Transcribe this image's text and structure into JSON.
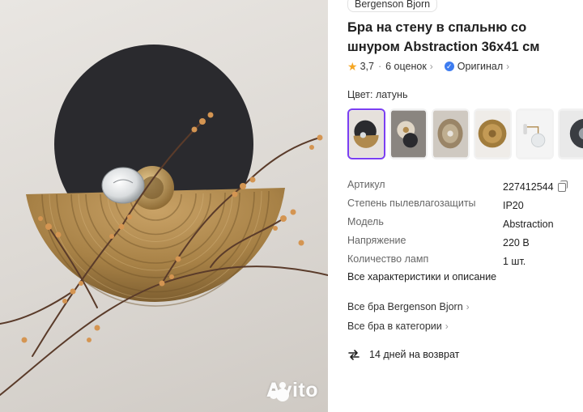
{
  "brand": {
    "label": "Bergenson Bjorn"
  },
  "product": {
    "title": "Бра на стену в спальню со шнуром Abstraction 36x41 см"
  },
  "rating": {
    "value": "3,7",
    "reviews": "6 оценок",
    "original": "Оригинал"
  },
  "color": {
    "label": "Цвет: латунь"
  },
  "thumbnails": [
    {
      "name": "thumb-1",
      "selected": true
    },
    {
      "name": "thumb-2",
      "selected": false
    },
    {
      "name": "thumb-3",
      "selected": false
    },
    {
      "name": "thumb-4",
      "selected": false
    },
    {
      "name": "thumb-5",
      "selected": false
    },
    {
      "name": "thumb-6",
      "selected": false
    }
  ],
  "specs": [
    {
      "key": "Артикул",
      "value": "227412544"
    },
    {
      "key": "Степень пылевлагозащиты",
      "value": "IP20"
    },
    {
      "key": "Модель",
      "value": "Abstraction"
    },
    {
      "key": "Напряжение",
      "value": "220 В"
    },
    {
      "key": "Количество ламп",
      "value": "1 шт."
    }
  ],
  "links": {
    "all_specs": "Все характеристики и описание",
    "brand_all": "Все бра Bergenson Bjorn",
    "category_all": "Все бра в категории"
  },
  "returns": {
    "label": "14 дней на возврат"
  },
  "watermark": {
    "label": "Avito"
  },
  "colors": {
    "accent": "#7b3ff2",
    "star": "#f5a623",
    "verified": "#3d7cf0",
    "brass": "#b08a4e",
    "disc": "#2a2a2e"
  }
}
